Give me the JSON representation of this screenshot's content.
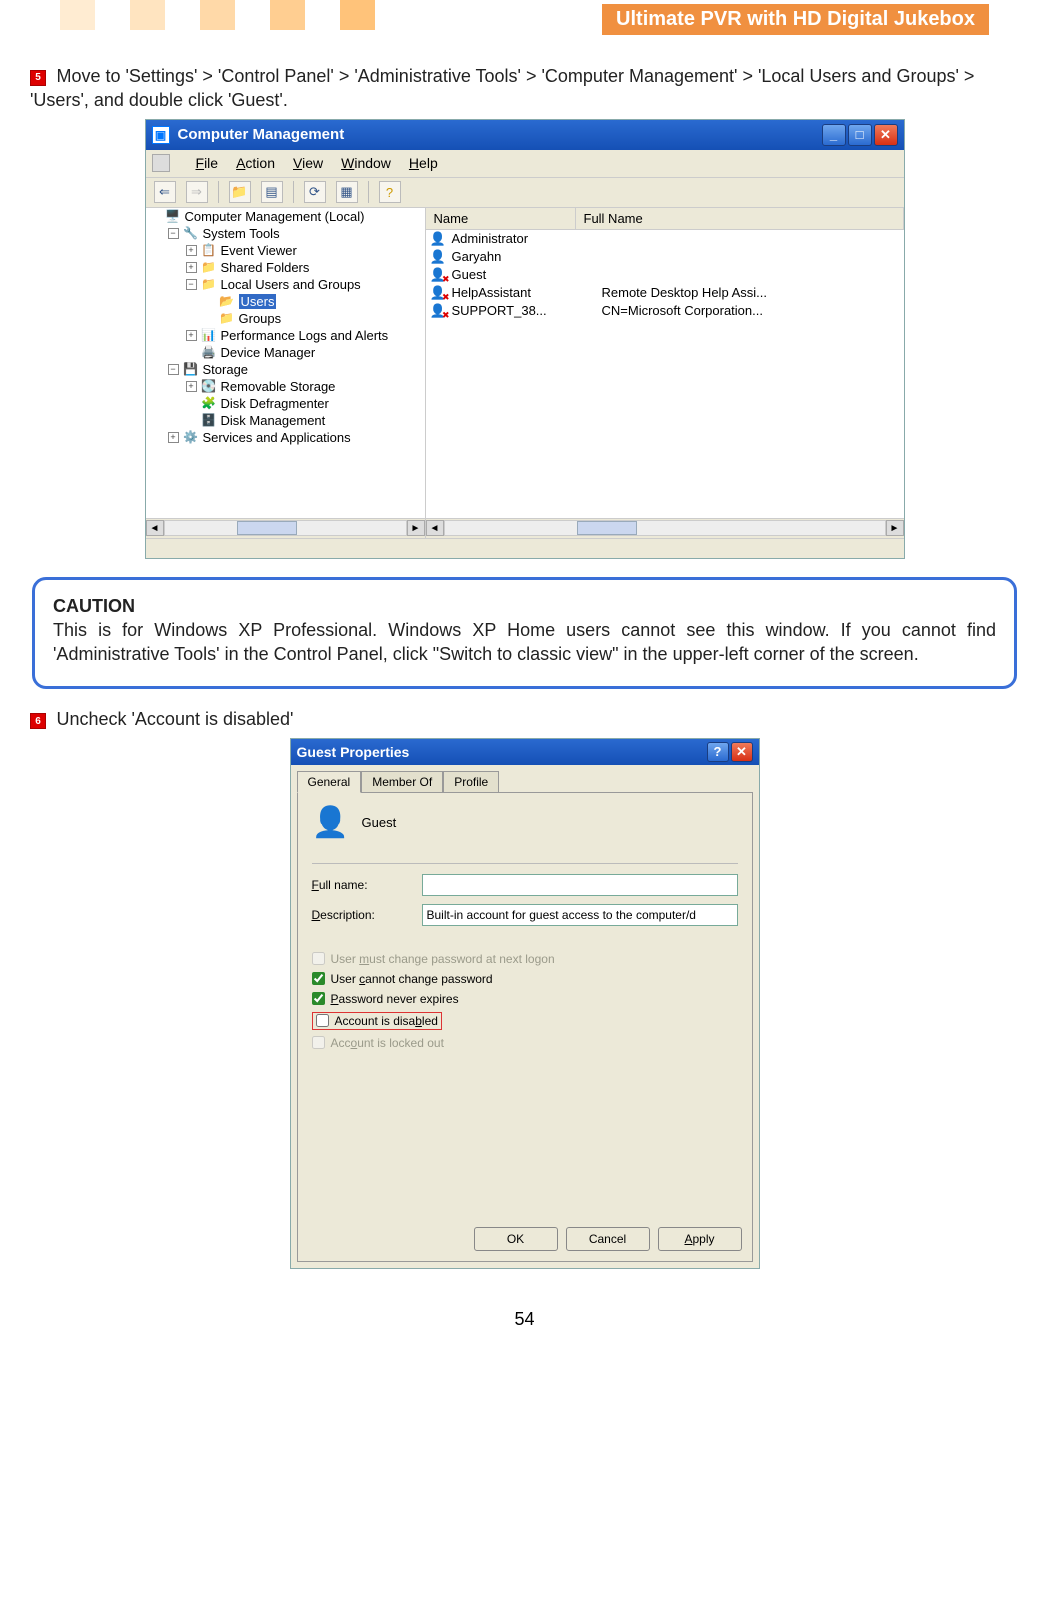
{
  "header": {
    "title": "Ultimate PVR with HD Digital Jukebox"
  },
  "step5": {
    "num": "5",
    "text": "Move to 'Settings' > 'Control Panel' > 'Administrative Tools' > 'Computer Management' > 'Local Users and Groups' > 'Users', and double click 'Guest'."
  },
  "cm_window": {
    "title": "Computer Management",
    "menu": {
      "file": "File",
      "action": "Action",
      "view": "View",
      "window": "Window",
      "help": "Help"
    },
    "tree": {
      "root": "Computer Management (Local)",
      "system_tools": "System Tools",
      "event_viewer": "Event Viewer",
      "shared_folders": "Shared Folders",
      "local_users": "Local Users and Groups",
      "users": "Users",
      "groups": "Groups",
      "perf": "Performance Logs and Alerts",
      "device_mgr": "Device Manager",
      "storage": "Storage",
      "removable": "Removable Storage",
      "defrag": "Disk Defragmenter",
      "diskmgmt": "Disk Management",
      "services": "Services and Applications"
    },
    "list": {
      "col_name": "Name",
      "col_full": "Full Name",
      "rows": [
        {
          "name": "Administrator",
          "full": "",
          "disabled": false
        },
        {
          "name": "Garyahn",
          "full": "",
          "disabled": false
        },
        {
          "name": "Guest",
          "full": "",
          "disabled": true
        },
        {
          "name": "HelpAssistant",
          "full": "Remote Desktop Help Assi...",
          "disabled": true
        },
        {
          "name": "SUPPORT_38...",
          "full": "CN=Microsoft Corporation...",
          "disabled": true
        }
      ]
    }
  },
  "caution": {
    "title": "CAUTION",
    "body": "This is for Windows XP Professional. Windows XP Home users cannot see this window. If you cannot find 'Administrative Tools' in the Control Panel, click \"Switch to classic view\" in the upper-left corner of the screen."
  },
  "step6": {
    "num": "6",
    "text": "Uncheck 'Account is disabled'"
  },
  "dialog": {
    "title": "Guest Properties",
    "tabs": {
      "general": "General",
      "member": "Member Of",
      "profile": "Profile"
    },
    "guest_label": "Guest",
    "fullname_label": "Full name:",
    "fullname_value": "",
    "desc_label": "Description:",
    "desc_value": "Built-in account for guest access to the computer/d",
    "chk_mustchange": "User must change password at next logon",
    "chk_cannot": "User cannot change password",
    "chk_never": "Password never expires",
    "chk_disabled": "Account is disabled",
    "chk_locked": "Account is locked out",
    "btn_ok": "OK",
    "btn_cancel": "Cancel",
    "btn_apply": "Apply"
  },
  "page_number": "54"
}
